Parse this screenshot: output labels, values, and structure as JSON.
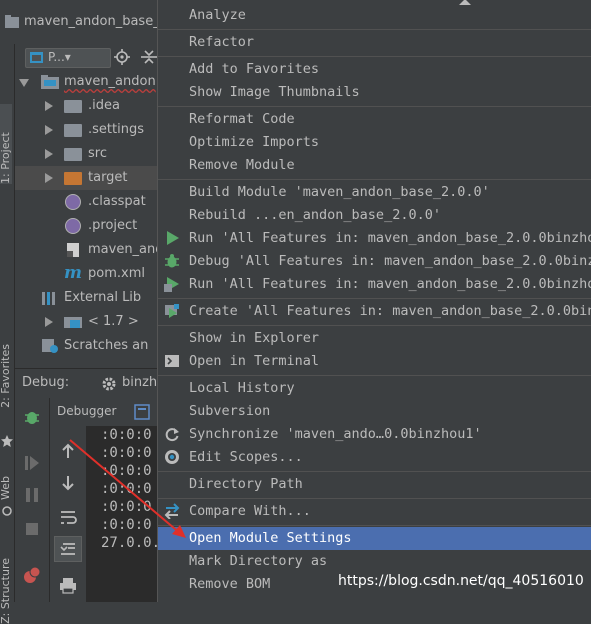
{
  "titlebar": {
    "title": "maven_andon_base_"
  },
  "side_tabs": {
    "project": "1: Project",
    "favorites": "2: Favorites",
    "web": "Web",
    "structure": "Z: Structure"
  },
  "project_view": {
    "selector": "P...▾"
  },
  "tree": [
    {
      "label": "maven_andon",
      "kind": "module",
      "expanded": true
    },
    {
      "label": ".idea",
      "kind": "folder"
    },
    {
      "label": ".settings",
      "kind": "folder"
    },
    {
      "label": "src",
      "kind": "folder"
    },
    {
      "label": "target",
      "kind": "folder-orange",
      "highlight": true
    },
    {
      "label": ".classpat",
      "kind": "file"
    },
    {
      "label": ".project",
      "kind": "file"
    },
    {
      "label": "maven_and",
      "kind": "file"
    },
    {
      "label": "pom.xml",
      "kind": "maven"
    },
    {
      "label": "External Lib",
      "kind": "library"
    },
    {
      "label": "< 1.7 >",
      "kind": "jdk"
    },
    {
      "label": "Scratches an",
      "kind": "scratch"
    }
  ],
  "debug": {
    "label": "Debug:",
    "config": "binzh",
    "tab_debugger": "Debugger"
  },
  "console_lines": [
    ":0:0:0",
    ":0:0:0",
    ":0:0:0",
    ":0:0:0",
    ":0:0:0",
    ":0:0:0",
    "27.0.0."
  ],
  "menu": {
    "items": [
      {
        "label": "Analyze",
        "group": 0
      },
      {
        "label": "Refactor",
        "group": 1
      },
      {
        "label": "Add to Favorites",
        "group": 2
      },
      {
        "label": "Show Image Thumbnails",
        "group": 2
      },
      {
        "label": "Reformat Code",
        "group": 3
      },
      {
        "label": "Optimize Imports",
        "group": 3
      },
      {
        "label": "Remove Module",
        "group": 3
      },
      {
        "label": "Build Module 'maven_andon_base_2.0.0'",
        "group": 4
      },
      {
        "label": "Rebuild ...en_andon_base_2.0.0'",
        "group": 4
      },
      {
        "label": "Run 'All Features in: maven_andon_base_2.0.0binzhou",
        "group": 4,
        "icon": "run-icon"
      },
      {
        "label": "Debug 'All Features in: maven_andon_base_2.0.0binzh",
        "group": 4,
        "icon": "debug-icon"
      },
      {
        "label": "Run 'All Features in: maven_andon_base_2.0.0binzhou",
        "group": 4,
        "icon": "coverage-icon"
      },
      {
        "label": "Create 'All Features in: maven_andon_base_2.0.0binz",
        "group": 5,
        "icon": "create-config-icon"
      },
      {
        "label": "Show in Explorer",
        "group": 6
      },
      {
        "label": "Open in Terminal",
        "group": 6,
        "icon": "terminal-icon"
      },
      {
        "label": "Local History",
        "group": 7
      },
      {
        "label": "Subversion",
        "group": 7
      },
      {
        "label": "Synchronize 'maven_ando…0.0binzhou1'",
        "group": 7,
        "icon": "sync-icon"
      },
      {
        "label": "Edit Scopes...",
        "group": 7,
        "icon": "scopes-icon"
      },
      {
        "label": "Directory Path",
        "group": 8
      },
      {
        "label": "Compare With...",
        "group": 9,
        "icon": "compare-icon"
      },
      {
        "label": "Open Module Settings",
        "group": 10,
        "selected": true
      },
      {
        "label": "Mark Directory as",
        "group": 10
      },
      {
        "label": "Remove BOM",
        "group": 10
      }
    ]
  },
  "watermark": "https://blog.csdn.net/qq_40516010",
  "colors": {
    "menu_bg": "#3c3f41",
    "selection": "#4b6eaf",
    "run_green": "#59a869",
    "annotation_red": "#e0302a"
  }
}
